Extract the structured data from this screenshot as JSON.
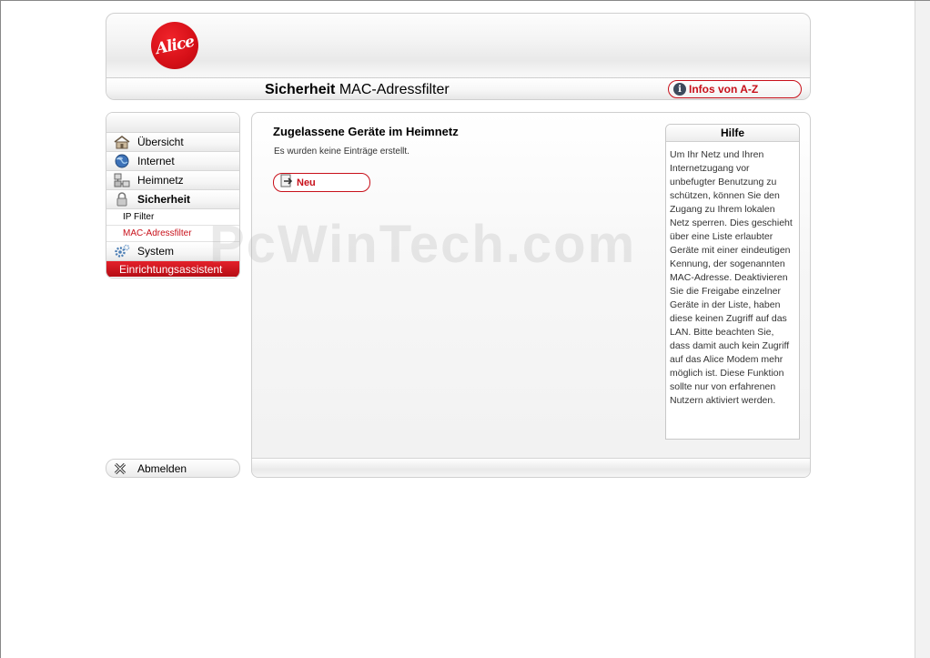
{
  "header": {
    "logo_text": "Alice",
    "title_bold": "Sicherheit",
    "title_rest": "MAC-Adressfilter",
    "infos_label": "Infos von A-Z"
  },
  "sidebar": {
    "items": [
      {
        "label": "Übersicht",
        "icon": "home-icon"
      },
      {
        "label": "Internet",
        "icon": "globe-icon"
      },
      {
        "label": "Heimnetz",
        "icon": "network-icon"
      },
      {
        "label": "Sicherheit",
        "icon": "lock-icon"
      }
    ],
    "sub_items": [
      {
        "label": "IP Filter"
      },
      {
        "label": "MAC-Adressfilter"
      }
    ],
    "system": {
      "label": "System",
      "icon": "gear-icon"
    },
    "wizard_label": "Einrichtungsassistent",
    "logout_label": "Abmelden",
    "active_color": "#c8101a"
  },
  "main": {
    "section_title": "Zugelassene Geräte im Heimnetz",
    "empty_message": "Es wurden keine Einträge erstellt.",
    "new_button": "Neu"
  },
  "help": {
    "title": "Hilfe",
    "text": "Um Ihr Netz und Ihren Internetzugang vor unbefugter Benutzung zu schützen, können Sie den Zugang zu Ihrem lokalen Netz sperren. Dies geschieht über eine Liste erlaubter Geräte mit einer eindeutigen Kennung, der sogenannten MAC-Adresse. Deaktivieren Sie die Freigabe einzelner Geräte in der Liste, haben diese keinen Zugriff auf das LAN. Bitte beachten Sie, dass damit auch kein Zugriff auf das Alice Modem mehr möglich ist. Diese Funktion sollte nur von erfahrenen Nutzern aktiviert werden."
  },
  "watermark": "PcWinTech.com"
}
